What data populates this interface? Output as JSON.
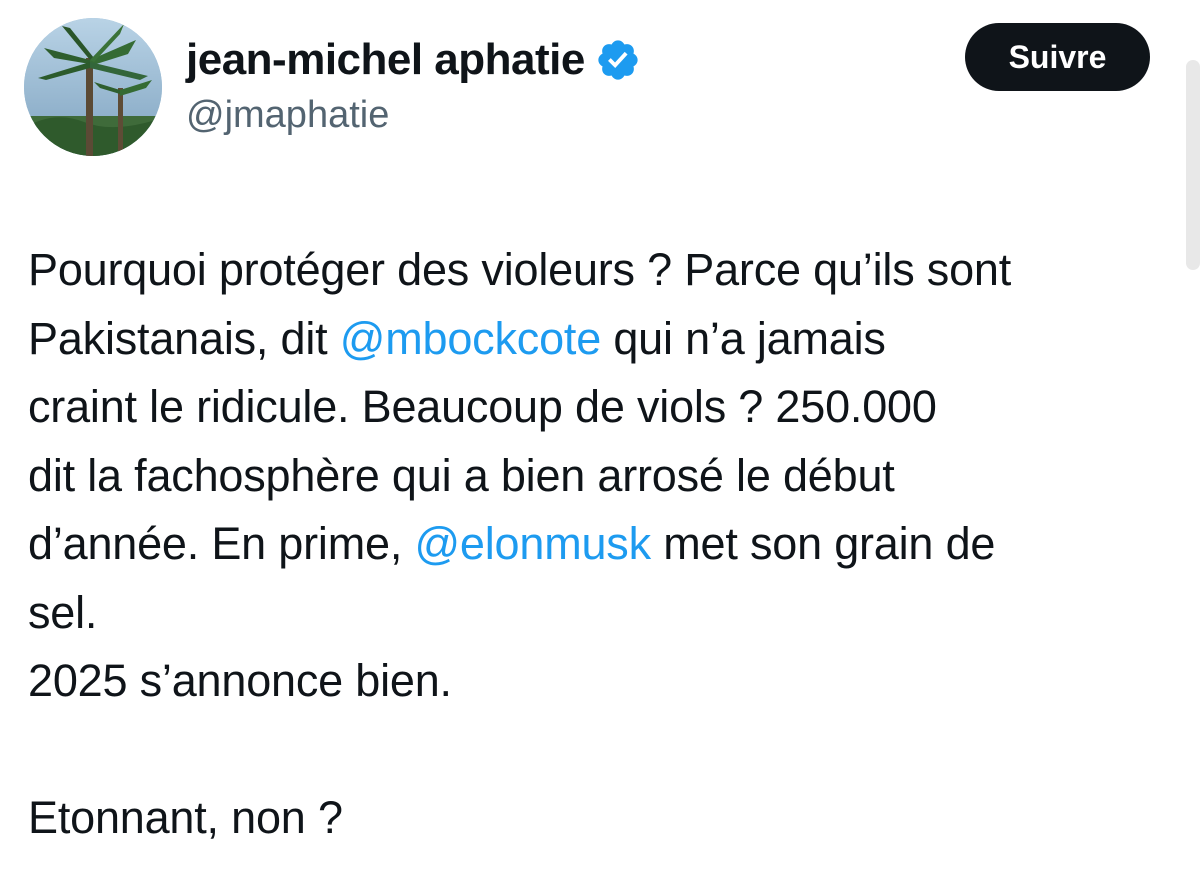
{
  "author": {
    "display_name": "jean-michel aphatie",
    "handle": "@jmaphatie",
    "verified": true,
    "verified_color": "#1d9bf0",
    "avatar_icon": "palm-tree-photo"
  },
  "actions": {
    "follow_label": "Suivre"
  },
  "tweet": {
    "line1": "Pourquoi protéger des violeurs ? Parce qu’ils sont",
    "line2_a": "Pakistanais, dit ",
    "line2_mention": "@mbockcote",
    "line2_b": " qui n’a jamais",
    "line3": "craint le ridicule. Beaucoup de viols ? 250.000",
    "line4": "dit la fachosphère qui a bien arrosé le début",
    "line5_a": "d’année. En prime, ",
    "line5_mention": "@elonmusk",
    "line5_b": " met son grain de",
    "line6": "sel.",
    "line7": "2025 s’annonce bien.",
    "line8": "Etonnant, non ?"
  },
  "colors": {
    "text": "#0f1419",
    "secondary": "#536471",
    "link": "#1d9bf0",
    "button_bg": "#0f1419"
  }
}
